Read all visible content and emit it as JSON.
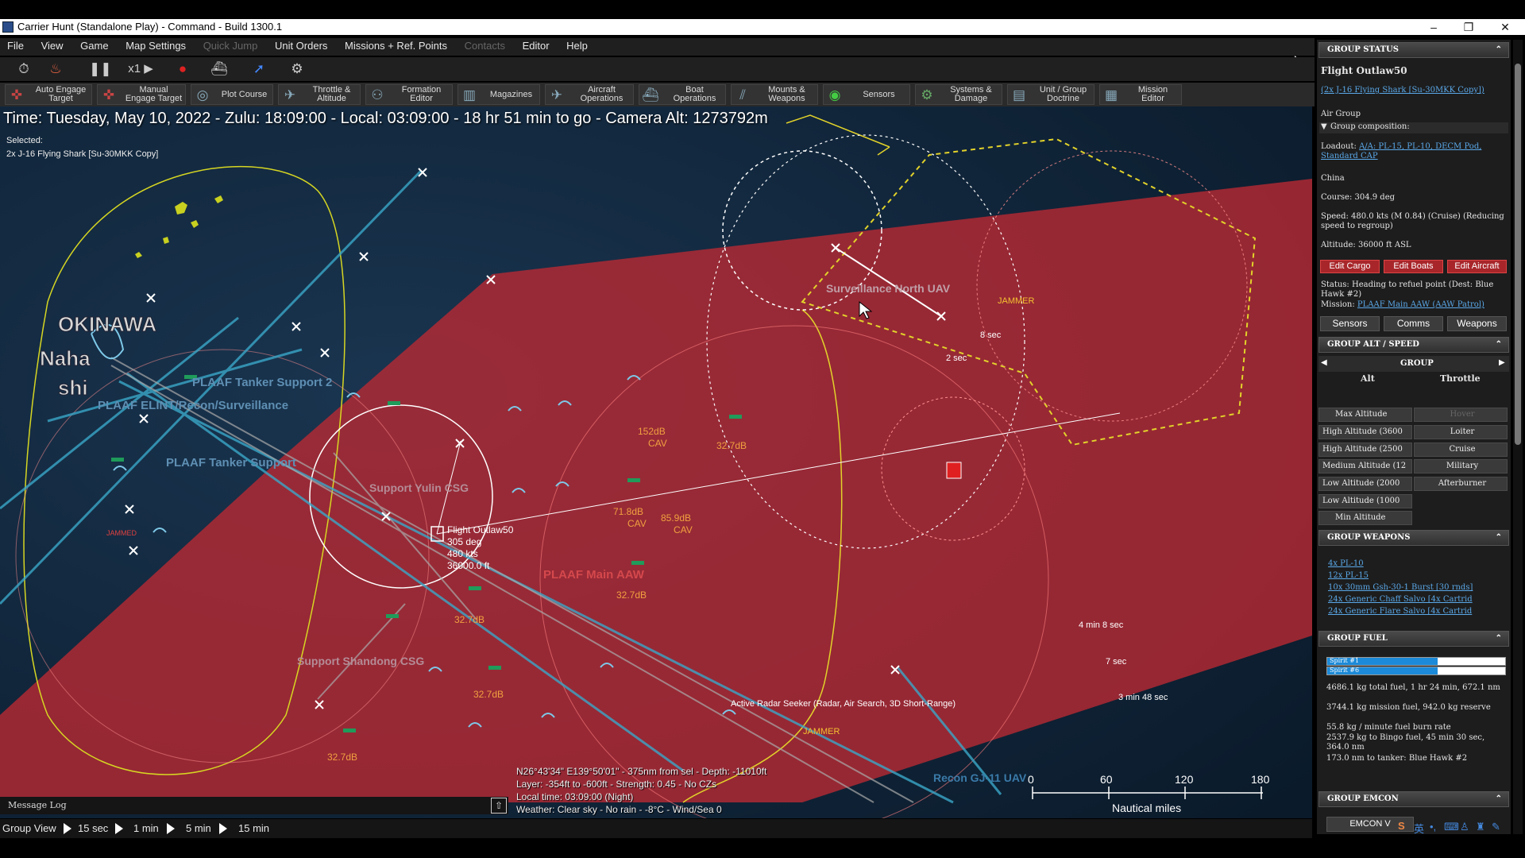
{
  "window": {
    "title": "Carrier Hunt (Standalone Play) - Command - Build 1300.1",
    "controls": [
      "–",
      "❐",
      "✕"
    ]
  },
  "menu": [
    {
      "label": "File",
      "enabled": true
    },
    {
      "label": "View",
      "enabled": true
    },
    {
      "label": "Game",
      "enabled": true
    },
    {
      "label": "Map Settings",
      "enabled": true
    },
    {
      "label": "Quick Jump",
      "enabled": false
    },
    {
      "label": "Unit Orders",
      "enabled": true
    },
    {
      "label": "Missions + Ref. Points",
      "enabled": true
    },
    {
      "label": "Contacts",
      "enabled": false
    },
    {
      "label": "Editor",
      "enabled": true
    },
    {
      "label": "Help",
      "enabled": true
    }
  ],
  "controls": {
    "speed": "x1"
  },
  "toolbar": [
    {
      "label": "Auto Engage\nTarget",
      "icon": "auto-engage-icon"
    },
    {
      "label": "Manual\nEngage Target",
      "icon": "manual-engage-icon"
    },
    {
      "label": "Plot Course",
      "icon": "plot-course-icon"
    },
    {
      "label": "Throttle &\nAltitude",
      "icon": "throttle-icon"
    },
    {
      "label": "Formation\nEditor",
      "icon": "formation-icon"
    },
    {
      "label": "Magazines",
      "icon": "magazines-icon"
    },
    {
      "label": "Aircraft\nOperations",
      "icon": "aircraft-icon"
    },
    {
      "label": "Boat\nOperations",
      "icon": "boat-icon"
    },
    {
      "label": "Mounts &\nWeapons",
      "icon": "weapons-icon"
    },
    {
      "label": "Sensors",
      "icon": "sensors-icon"
    },
    {
      "label": "Systems &\nDamage",
      "icon": "systems-icon"
    },
    {
      "label": "Unit / Group\nDoctrine",
      "icon": "doctrine-icon"
    },
    {
      "label": "Mission\nEditor",
      "icon": "mission-editor-icon"
    }
  ],
  "status_line": "Time: Tuesday, May 10, 2022 - Zulu: 18:09:00 - Local: 03:09:00 - 18 hr 51 min to go -  Camera Alt: 1273792m",
  "selected": {
    "label": "Selected:",
    "unit": "2x J-16 Flying Shark [Su-30MKK Copy]"
  },
  "map": {
    "labels": {
      "okinawa": "OKINAWA",
      "naha": "Naha",
      "shi": "shi",
      "tanker2": "PLAAF Tanker Support 2",
      "elint": "PLAAF ELINT/Recon/Surveillance",
      "tanker": "PLAAF Tanker Support",
      "support_yulin": "Support Yulin CSG",
      "support_shandong": "Support Shandong CSG",
      "main_aaw": "PLAAF Main AAW",
      "surv_uav": "Surveillance North UAV",
      "recon_uav": "Recon GJ-11 UAV"
    },
    "selected_unit": {
      "name": "Flight Outlaw50",
      "heading": "305 deg",
      "speed": "480 kts",
      "alt": "36000.0 ft"
    },
    "db": {
      "d1": "152dB",
      "d2": "32.7dB",
      "d3": "71.8dB",
      "d4": "85.9dB",
      "d5": "32.7dB",
      "d6": "32.7dB",
      "d7": "32.7dB",
      "d8": "32.7dB"
    },
    "cav": "CAV",
    "jammer": "JAMMER",
    "jammed": "JAMMED",
    "timers": {
      "t1": "8 sec",
      "t2": "2 sec",
      "t3": "4 min 8 sec",
      "t4": "7 sec",
      "t5": "3 min 48 sec"
    },
    "radar_seeker": "Active Radar Seeker (Radar, Air Search, 3D Short-Range)",
    "scale": {
      "ticks": [
        "0",
        "60",
        "120",
        "180"
      ],
      "unit": "Nautical miles"
    }
  },
  "cursor_info": {
    "line1": "N26°43'34\" E139°50'01\" - 375nm from sel - Depth: -11010ft",
    "line2": "Layer: -354ft to -600ft - Strength: 0.45 - No CZs",
    "line3": "Local time: 03:09:00 (Night)",
    "line4": "Weather: Clear sky - No rain - -8°C - Wind/Sea 0"
  },
  "message_log": "Message Log",
  "bottom": {
    "group_view": "Group View",
    "steps": [
      "15 sec",
      "1 min",
      "5 min",
      "15 min"
    ]
  },
  "panel": {
    "group_status": {
      "header": "GROUP STATUS",
      "name": "Flight Outlaw50",
      "composition_link": "(2x J-16 Flying Shark [Su-30MKK Copy])",
      "type": "Air Group",
      "composition_toggle": "Group composition:",
      "loadout_label": "Loadout:",
      "loadout": "A/A: PL-15, PL-10, DECM Pod, Standard CAP",
      "side": "China",
      "course": "Course: 304.9 deg",
      "speed": "Speed: 480.0 kts (M 0.84) (Cruise) (Reducing speed to regroup)",
      "altitude": "Altitude: 36000 ft ASL",
      "buttons": [
        "Edit Cargo",
        "Edit Boats",
        "Edit Aircraft"
      ],
      "status": "Status: Heading to refuel point (Dest: Blue Hawk #2)",
      "mission_label": "Mission:",
      "mission": "PLAAF Main AAW (AAW Patrol)",
      "tabs": [
        "Sensors",
        "Comms",
        "Weapons"
      ]
    },
    "alt_speed": {
      "header": "GROUP ALT / SPEED",
      "group": "GROUP",
      "alt": "Alt",
      "throttle": "Throttle",
      "altitudes": [
        "Max Altitude",
        "High Altitude (3600",
        "High Altitude (2500",
        "Medium Altitude (12",
        "Low Altitude (2000",
        "Low Altitude (1000",
        "Min Altitude"
      ],
      "throttles": [
        "Hover",
        "Loiter",
        "Cruise",
        "Military",
        "Afterburner"
      ]
    },
    "weapons": {
      "header": "GROUP WEAPONS",
      "items": [
        "4x PL-10",
        "12x PL-15",
        "10x 30mm Gsh-30-1 Burst [30 rnds]",
        "24x Generic Chaff Salvo [4x Cartrid",
        "24x Generic Flare Salvo [4x Cartrid"
      ]
    },
    "fuel": {
      "header": "GROUP FUEL",
      "bars": [
        {
          "name": "Spirit #1",
          "fraction": 0.62
        },
        {
          "name": "Spirit #6",
          "fraction": 0.62
        }
      ],
      "lines": [
        "4686.1 kg total fuel, 1 hr 24 min, 672.1 nm",
        "3744.1 kg mission fuel, 942.0 kg reserve",
        "55.8 kg / minute fuel burn rate",
        "2537.9 kg to Bingo fuel, 45 min 30 sec, 364.0 nm",
        "173.0 nm to tanker: Blue Hawk #2"
      ]
    },
    "emcon": {
      "header": "GROUP EMCON",
      "button": "EMCON V"
    }
  },
  "taskbar": {
    "ime": "英"
  }
}
